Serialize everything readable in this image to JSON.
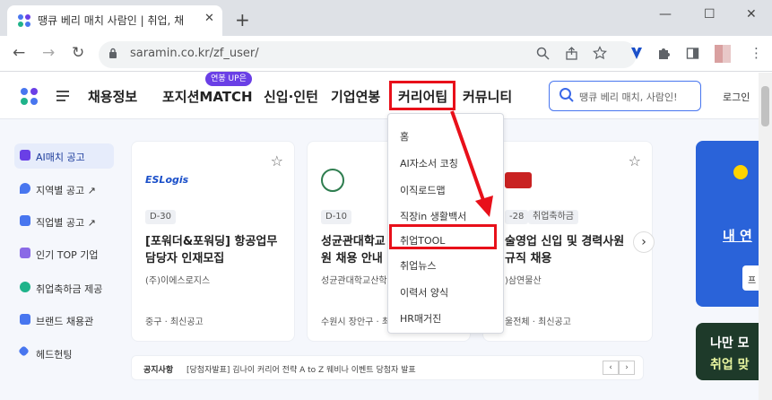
{
  "browser": {
    "tab_title": "땡큐 베리 매치 사람인 | 취업, 채",
    "tab_close": "✕",
    "new_tab": "+",
    "window_controls": [
      "—",
      "☐",
      "✕"
    ],
    "nav": {
      "back": "←",
      "forward": "→",
      "reload": "↻"
    },
    "url": "saramin.co.kr/zf_user/",
    "toolbar_icons": [
      "zoom-icon",
      "share-icon",
      "star-icon",
      "extension-v-icon",
      "puzzle-icon",
      "sidepanel-icon",
      "profile-icon",
      "menu-icon"
    ]
  },
  "header": {
    "nav": [
      "채용정보",
      "포지션MATCH",
      "신입·인턴",
      "기업연봉",
      "커리어팁",
      "커뮤니티"
    ],
    "badge": "연봉 UP은",
    "search_placeholder": "땡큐 베리 매치, 사람인!",
    "login": "로그인"
  },
  "sidebar": [
    {
      "label": "AI매치 공고",
      "icon": "ai-icon",
      "color": "#6a3fe6"
    },
    {
      "label": "지역별 공고 ↗",
      "icon": "pin-icon",
      "color": "#4876ef"
    },
    {
      "label": "직업별 공고 ↗",
      "icon": "briefcase-icon",
      "color": "#4876ef"
    },
    {
      "label": "인기 TOP 기업",
      "icon": "crown-icon",
      "color": "#8a6ae6"
    },
    {
      "label": "취업축하금 제공",
      "icon": "coin-icon",
      "color": "#1fb38a"
    },
    {
      "label": "브랜드 채용관",
      "icon": "brand-icon",
      "color": "#4876ef"
    },
    {
      "label": "헤드헌팅",
      "icon": "pushpin-icon",
      "color": "#4876ef"
    }
  ],
  "cards": [
    {
      "logo": "ESLogis",
      "tag": "D-30",
      "extra_tag": "",
      "title": "[포워더&포워딩] 항공업무 담당자 인재모집",
      "company": "(주)이에스로지스",
      "location": "중구 · 최신공고"
    },
    {
      "logo": "",
      "tag": "D-10",
      "extra_tag": "",
      "title": "성균관대학교 직원 채용 안내",
      "company": "성균관대학교산학",
      "location": "수원시 장안구 · 최"
    },
    {
      "logo": "",
      "tag": "-28",
      "extra_tag": "취업축하금",
      "title": "술영업 신입 및 경력사원 규직 채용",
      "company": ")삼연물산",
      "location": "울전체 · 최신공고"
    }
  ],
  "next_arrow": "›",
  "notice": {
    "label": "공지사항",
    "text": "[당첨자발표] 김나이 커리어 전략 A to Z 웨비나 이벤트 당첨자 발표",
    "prev": "‹",
    "next": "›"
  },
  "banner1": {
    "text": "내 연",
    "button": "프"
  },
  "banner2": {
    "line1": "나만 모",
    "line2": "취업 맞"
  },
  "dropdown": {
    "items": [
      "홈",
      "AI자소서 코칭",
      "이직로드맵",
      "직장in 생활백서",
      "취업TOOL",
      "취업뉴스",
      "이력서 양식",
      "HR매거진"
    ],
    "highlighted": "취업TOOL"
  },
  "colors": {
    "accent": "#4876ef",
    "highlight": "#e8101a",
    "badge": "#6a3fe6"
  }
}
